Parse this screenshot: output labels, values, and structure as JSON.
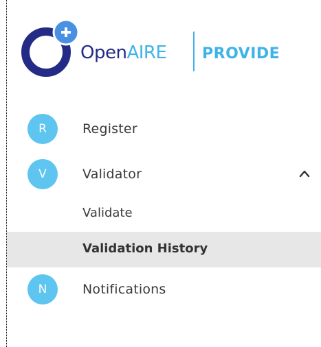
{
  "brand": {
    "name_open": "Open",
    "name_aire": "AIRE",
    "product": "PROVIDE",
    "colors": {
      "navy": "#232b86",
      "sky": "#3fb3e8",
      "plus": "#4a90e2"
    }
  },
  "menu": {
    "items": [
      {
        "badge": "R",
        "label": "Register"
      },
      {
        "badge": "V",
        "label": "Validator",
        "expanded": true,
        "icon": "chevron-up-icon",
        "children": [
          {
            "label": "Validate"
          },
          {
            "label": "Validation History",
            "active": true
          }
        ]
      },
      {
        "badge": "N",
        "label": "Notifications"
      }
    ],
    "badge_color": "#5ec4f0",
    "active_bg": "#e7e7e7"
  }
}
